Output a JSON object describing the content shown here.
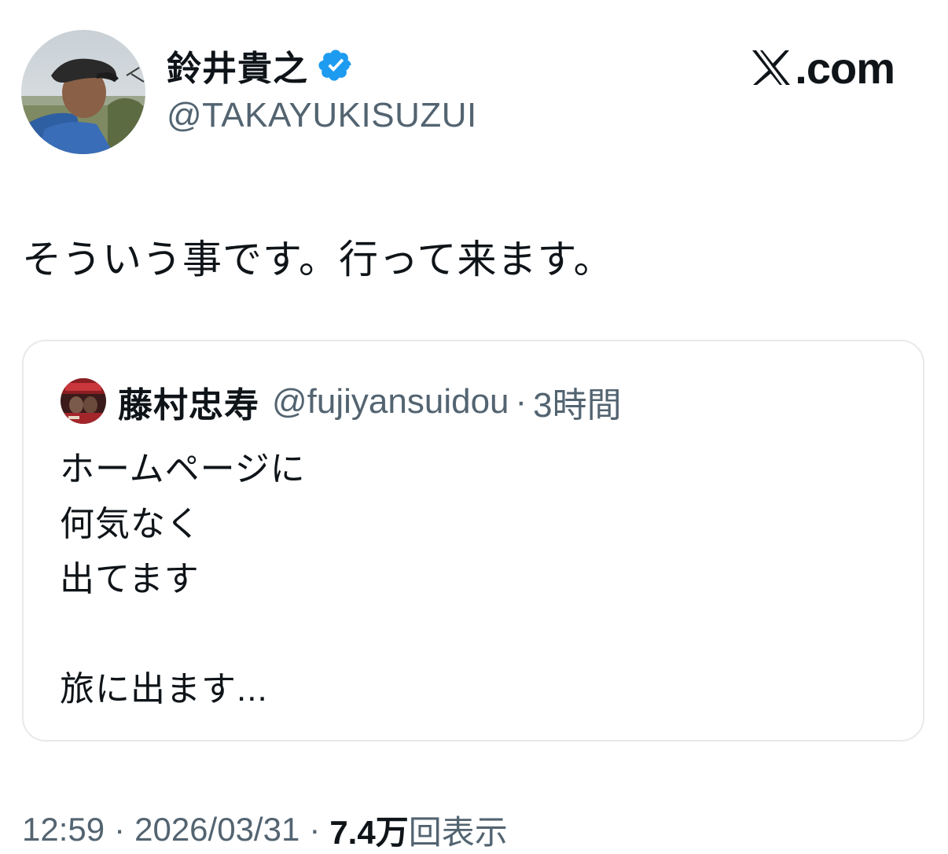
{
  "author": {
    "display_name": "鈴井貴之",
    "handle": "@TAKAYUKISUZUI",
    "verified_icon": "verified-badge-icon",
    "avatar": "profile-photo"
  },
  "brand": {
    "logo_icon": "x-logo-icon",
    "text": ".com"
  },
  "tweet": {
    "text": "そういう事です。行って来ます。"
  },
  "quote": {
    "author_name": "藤村忠寿",
    "author_handle": "@fujiyansuidou",
    "separator": "·",
    "time": "3時間",
    "lines": [
      "ホームページに",
      "何気なく",
      "出てます",
      "",
      "旅に出ます..."
    ]
  },
  "meta": {
    "time": "12:59",
    "separator_1": "·",
    "date": "2026/03/31",
    "separator_2": "·",
    "views_count": "7.4万",
    "views_label": "回表示"
  },
  "colors": {
    "text_primary": "#0f1419",
    "text_secondary": "#536471",
    "verified_blue": "#1d9bf0",
    "border": "#e7e9ea"
  }
}
